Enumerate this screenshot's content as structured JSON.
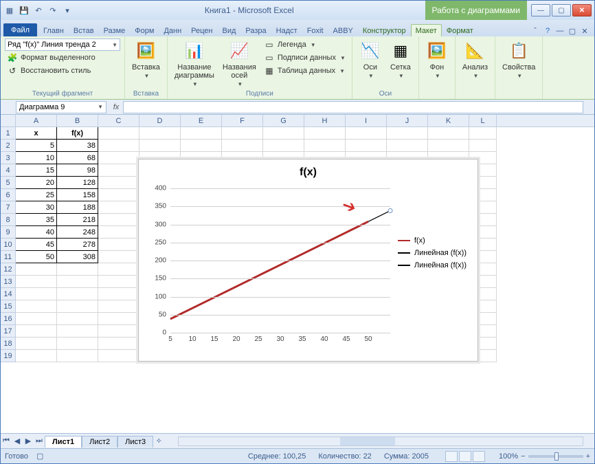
{
  "title": {
    "doc": "Книга1",
    "app": "Microsoft Excel",
    "chart_tools": "Работа с диаграммами"
  },
  "tabs": {
    "file": "Файл",
    "items": [
      "Главн",
      "Встав",
      "Разме",
      "Форм",
      "Данн",
      "Рецен",
      "Вид",
      "Разра",
      "Надст",
      "Foxit",
      "ABBY"
    ],
    "chart_items": [
      "Конструктор",
      "Макет",
      "Формат"
    ],
    "chart_active_idx": 1
  },
  "ribbon": {
    "g1": {
      "label": "Текущий фрагмент",
      "combo": "Ряд \"f(x)\" Линия тренда 2",
      "fmt": "Формат выделенного",
      "reset": "Восстановить стиль"
    },
    "g2": {
      "label": "Вставка",
      "btn": "Вставка"
    },
    "g3": {
      "label": "Подписи",
      "name": "Название\nдиаграммы",
      "axes": "Названия\nосей",
      "legend": "Легенда",
      "labels": "Подписи данных",
      "table": "Таблица данных"
    },
    "g4": {
      "label": "Оси",
      "axes": "Оси",
      "grid": "Сетка"
    },
    "g5": {
      "bg": "Фон",
      "analysis": "Анализ",
      "props": "Свойства"
    }
  },
  "namebox": "Диаграмма 9",
  "fx_label": "fx",
  "columns": [
    "A",
    "B",
    "C",
    "D",
    "E",
    "F",
    "G",
    "H",
    "I",
    "J",
    "K",
    "L"
  ],
  "headers": {
    "x": "x",
    "fx": "f(x)"
  },
  "table_data": [
    {
      "x": 5,
      "fx": 38
    },
    {
      "x": 10,
      "fx": 68
    },
    {
      "x": 15,
      "fx": 98
    },
    {
      "x": 20,
      "fx": 128
    },
    {
      "x": 25,
      "fx": 158
    },
    {
      "x": 30,
      "fx": 188
    },
    {
      "x": 35,
      "fx": 218
    },
    {
      "x": 40,
      "fx": 248
    },
    {
      "x": 45,
      "fx": 278
    },
    {
      "x": 50,
      "fx": 308
    }
  ],
  "chart_data": {
    "type": "line",
    "title": "f(x)",
    "x": [
      5,
      10,
      15,
      20,
      25,
      30,
      35,
      40,
      45,
      50
    ],
    "series": [
      {
        "name": "f(x)",
        "color": "#b22a2a",
        "values": [
          38,
          68,
          98,
          128,
          158,
          188,
          218,
          248,
          278,
          308
        ]
      },
      {
        "name": "Линейная (f(x))",
        "color": "#000000",
        "values": [
          38,
          68,
          98,
          128,
          158,
          188,
          218,
          248,
          278,
          308,
          338
        ]
      },
      {
        "name": "Линейная (f(x))",
        "color": "#000000",
        "values": [
          38,
          68,
          98,
          128,
          158,
          188,
          218,
          248,
          278,
          308,
          338
        ]
      }
    ],
    "yticks": [
      0,
      50,
      100,
      150,
      200,
      250,
      300,
      350,
      400
    ],
    "xticks": [
      5,
      10,
      15,
      20,
      25,
      30,
      35,
      40,
      45,
      50
    ],
    "ylim": [
      0,
      400
    ],
    "xlim": [
      5,
      50
    ],
    "forecast_x": 55
  },
  "sheets": [
    "Лист1",
    "Лист2",
    "Лист3"
  ],
  "status": {
    "ready": "Готово",
    "avg_lbl": "Среднее:",
    "avg": "100,25",
    "cnt_lbl": "Количество:",
    "cnt": "22",
    "sum_lbl": "Сумма:",
    "sum": "2005",
    "zoom": "100%"
  }
}
